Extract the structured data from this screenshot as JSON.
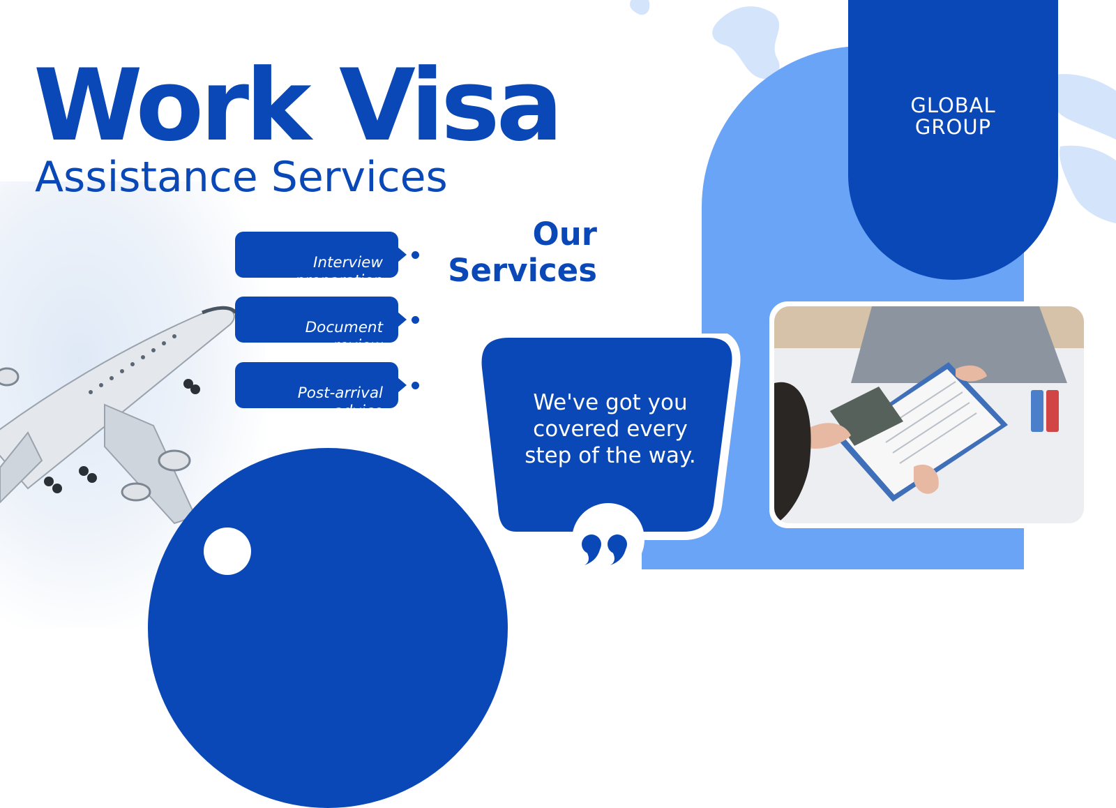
{
  "heading": {
    "title": "Work Visa",
    "subtitle": "Assistance Services"
  },
  "services": {
    "title": "Our\nServices",
    "items": [
      {
        "label": "Interview\npreparation"
      },
      {
        "label": "Document\nreview"
      },
      {
        "label": "Post-arrival\nadvice"
      }
    ]
  },
  "badge": {
    "label": "GLOBAL\nGROUP"
  },
  "quote": {
    "text": "We've got you\ncovered every\nstep of the way."
  },
  "colors": {
    "primary": "#0a48b7",
    "light": "#6aa4f7",
    "map": "#d4e4fb",
    "white": "#ffffff"
  },
  "icons": {
    "quote": "quote-icon",
    "airplane": "airplane-image",
    "photo": "visa-document-photo"
  }
}
